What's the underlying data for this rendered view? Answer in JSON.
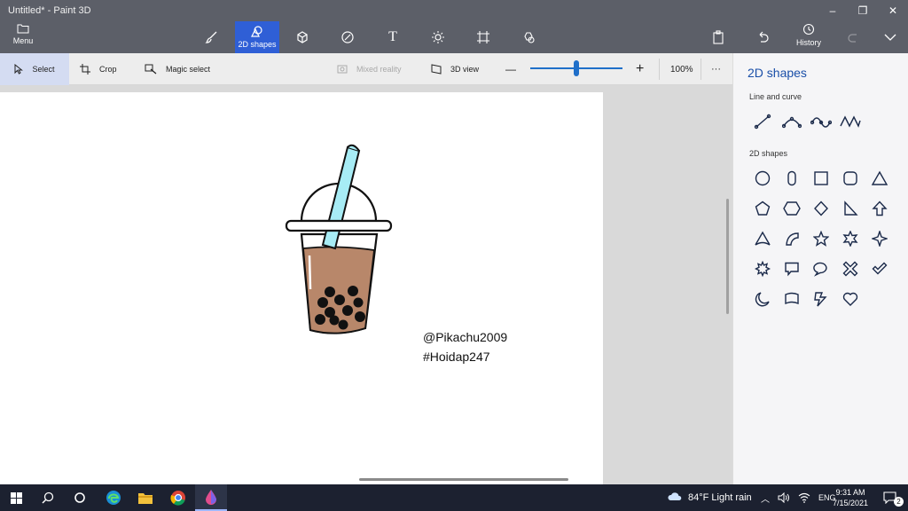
{
  "window": {
    "title": "Untitled* - Paint 3D",
    "controls": [
      "–",
      "❐",
      "✕"
    ]
  },
  "toolbar": {
    "menu_label": "Menu",
    "active_tool_label": "2D shapes",
    "history_label": "History"
  },
  "subbar": {
    "select_label": "Select",
    "crop_label": "Crop",
    "magic_select_label": "Magic select",
    "mixed_reality_label": "Mixed reality",
    "view3d_label": "3D view",
    "zoom_minus": "—",
    "zoom_plus": "+",
    "zoom_level": "100%",
    "more": "···"
  },
  "canvas": {
    "lines": [
      "@Pikachu2009",
      "#Hoidap247"
    ]
  },
  "panel": {
    "title": "2D shapes",
    "section_lines": "Line and curve",
    "section_shapes": "2D shapes"
  },
  "taskbar": {
    "weather": "84°F  Light rain",
    "lang": "ENG",
    "time": "9:31 AM",
    "date": "7/15/2021",
    "notif_count": "2"
  },
  "colors": {
    "accent": "#2f5fd6",
    "titlebar": "#5c5f68",
    "tea": "#b8876a",
    "straw": "#a7ecf5"
  }
}
